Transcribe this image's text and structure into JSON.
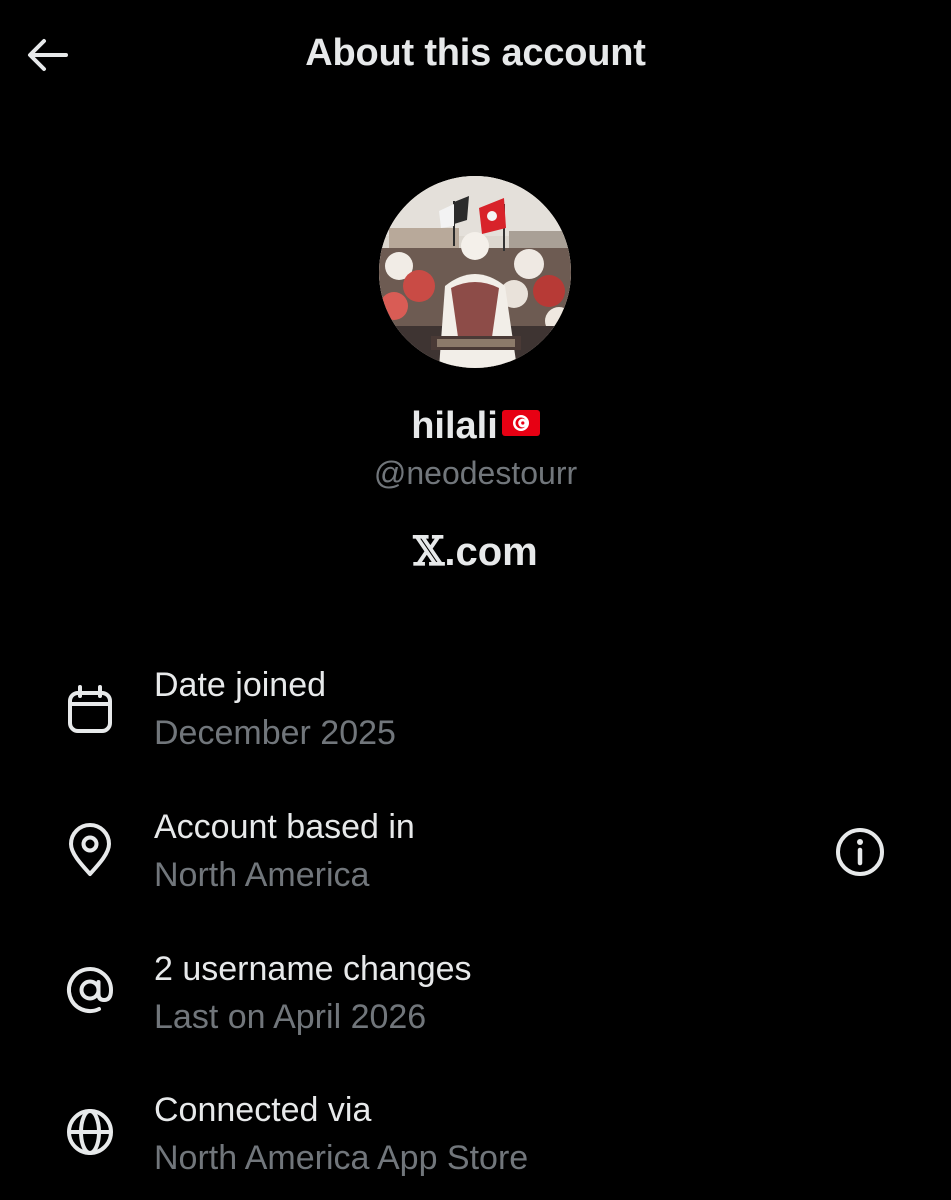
{
  "header": {
    "title": "About this account",
    "back_icon": "arrow-left-icon"
  },
  "profile": {
    "display_name": "hilali",
    "flag_icon": "tunisia-flag-icon",
    "handle": "@neodestourr",
    "platform_mark": "𝕏",
    "platform_suffix": ".com"
  },
  "details": [
    {
      "icon": "calendar-icon",
      "title": "Date joined",
      "value": "December 2025"
    },
    {
      "icon": "location-pin-icon",
      "title": "Account based in",
      "value": "North America",
      "trailing_icon": "info-icon"
    },
    {
      "icon": "at-sign-icon",
      "title": "2 username changes",
      "value": "Last on April 2026"
    },
    {
      "icon": "globe-icon",
      "title": "Connected via",
      "value": "North America App Store"
    }
  ],
  "colors": {
    "background": "#000000",
    "primary_text": "#e7e9ea",
    "secondary_text": "#71767b",
    "flag_red": "#e70013"
  }
}
